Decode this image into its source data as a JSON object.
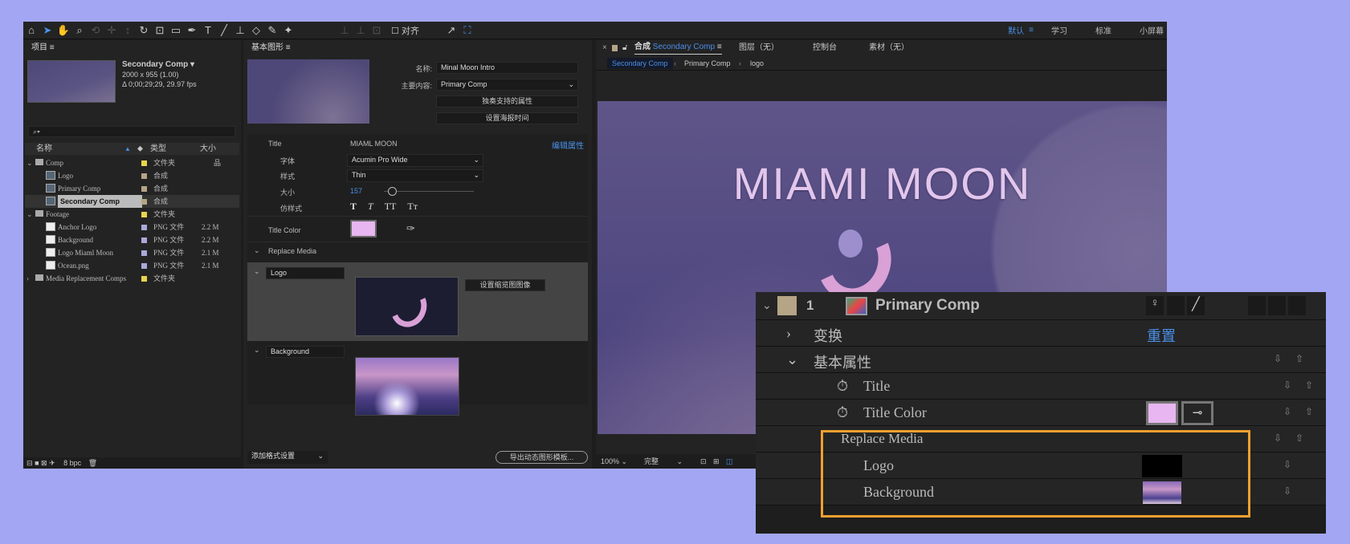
{
  "toolbar": {
    "align_label": "对齐",
    "workspaces": [
      "默认",
      "学习",
      "标准",
      "小屏幕"
    ],
    "active_workspace": "默认"
  },
  "project": {
    "title": "项目",
    "comp_name": "Secondary Comp ▾",
    "comp_size": "2000 x 955 (1.00)",
    "comp_duration": "Δ 0;00;29;29, 29.97 fps",
    "search_placeholder": "⌕▾",
    "columns": [
      "名称",
      "类型",
      "大小"
    ],
    "items": [
      {
        "name": "Comp",
        "type": "文件夹",
        "size": "",
        "indent": 0,
        "folder": true,
        "color": "#e8d44d"
      },
      {
        "name": "Logo",
        "type": "合成",
        "size": "",
        "indent": 1,
        "color": "#b5a486"
      },
      {
        "name": "Primary Comp",
        "type": "合成",
        "size": "",
        "indent": 1,
        "color": "#b5a486"
      },
      {
        "name": "Secondary Comp",
        "type": "合成",
        "size": "",
        "indent": 1,
        "color": "#b5a486",
        "selected": true
      },
      {
        "name": "Footage",
        "type": "文件夹",
        "size": "",
        "indent": 0,
        "folder": true,
        "color": "#e8d44d"
      },
      {
        "name": "Anchor Logo",
        "type": "PNG 文件",
        "size": "2.2 M",
        "indent": 1,
        "color": "#a9a9d9"
      },
      {
        "name": "Background",
        "type": "PNG 文件",
        "size": "2.2 M",
        "indent": 1,
        "color": "#a9a9d9"
      },
      {
        "name": "Logo Miaml Moon",
        "type": "PNG 文件",
        "size": "2.1 M",
        "indent": 1,
        "color": "#a9a9d9"
      },
      {
        "name": "Ocean.png",
        "type": "PNG 文件",
        "size": "2.1 M",
        "indent": 1,
        "color": "#a9a9d9"
      },
      {
        "name": "Media Replacement Comps",
        "type": "文件夹",
        "size": "",
        "indent": 0,
        "folder": true,
        "collapsed": true,
        "color": "#e8d44d"
      }
    ],
    "bpc": "8 bpc"
  },
  "eg": {
    "title": "基本图形",
    "name_label": "名称:",
    "name_value": "Minal Moon Intro",
    "primary_label": "主要内容:",
    "primary_value": "Primary Comp",
    "solo_button": "独奏支持的属性",
    "poster_button": "设置海报时间",
    "title_label": "Title",
    "title_value": "MIAML MOON",
    "edit_props": "编辑属性",
    "font_label": "字体",
    "font_value": "Acumin Pro Wide",
    "style_label": "样式",
    "style_value": "Thin",
    "size_label": "大小",
    "size_value": "157",
    "faux_label": "仿样式",
    "faux_buttons": [
      "T",
      "T",
      "TT",
      "Tт"
    ],
    "title_color_label": "Title Color",
    "title_color": "#e8b6f0",
    "replace_media": "Replace Media",
    "logo_field": "Logo",
    "set_thumb": "设置缩览图图像",
    "background_field": "Background",
    "add_format": "添加格式设置",
    "export": "导出动态图形模板..."
  },
  "viewer": {
    "tab_prefix": "合成",
    "tab_comp": "Secondary Comp",
    "other_tabs": [
      "图层（无）",
      "控制台",
      "素材（无）"
    ],
    "breadcrumbs": [
      "Secondary Comp",
      "Primary Comp",
      "logo"
    ],
    "headline": "MIAMI MOON",
    "zoom": "100%",
    "resolution": "完整"
  },
  "timeline": {
    "layer_num": "1",
    "layer_name": "Primary Comp",
    "label_color": "#b5a486",
    "transform": "变换",
    "reset": "重置",
    "essential": "基本属性",
    "title": "Title",
    "title_color": "Title Color",
    "swatch": "#e8b6f0",
    "replace_media": "Replace Media",
    "logo": "Logo",
    "background": "Background",
    "highlight": "#f0a030"
  }
}
